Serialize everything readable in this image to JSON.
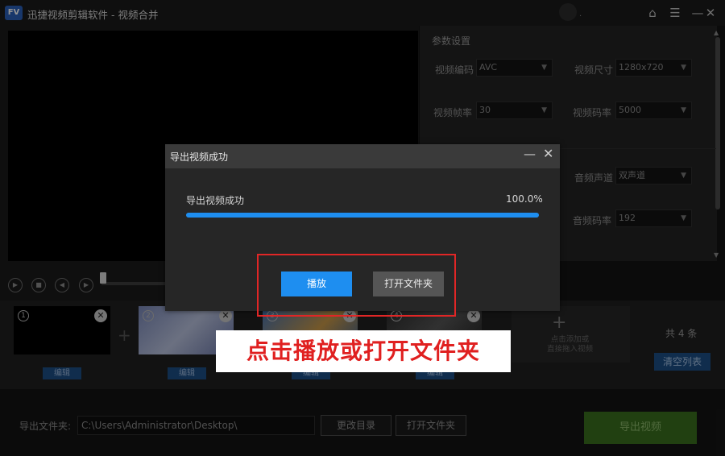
{
  "app": {
    "title": "迅捷视频剪辑软件 - 视频合并",
    "logo_text": "FV"
  },
  "window": {
    "home_icon": "⌂",
    "menu_icon": "☰",
    "close_icon": "✕",
    "user_suffix": "."
  },
  "settings": {
    "section_title": "参数设置",
    "params": [
      {
        "label": "视频编码",
        "value": "AVC"
      },
      {
        "label": "视频尺寸",
        "value": "1280x720"
      },
      {
        "label": "视频帧率",
        "value": "30"
      },
      {
        "label": "视频码率",
        "value": "5000"
      },
      {
        "label": "音频声道",
        "value": "双声道"
      },
      {
        "label": "音频码率",
        "value": "192"
      }
    ]
  },
  "clips": [
    {
      "num": "1",
      "edit": "编辑"
    },
    {
      "num": "2",
      "edit": "编辑"
    },
    {
      "num": "3",
      "edit": "编辑"
    },
    {
      "num": "4",
      "edit": "编辑"
    }
  ],
  "add_card": {
    "line1": "点击添加或",
    "line2": "直接拖入视频"
  },
  "count_text": "共 4 条",
  "clear_label": "清空列表",
  "export": {
    "folder_label": "导出文件夹:",
    "path": "C:\\Users\\Administrator\\Desktop\\",
    "change_dir": "更改目录",
    "open_folder": "打开文件夹",
    "export_video": "导出视频"
  },
  "modal": {
    "title": "导出视频成功",
    "status": "导出视频成功",
    "progress": 100.0,
    "progress_text": "100.0%",
    "play": "播放",
    "open_folder": "打开文件夹",
    "min_icon": "—",
    "close_icon": "✕"
  },
  "annotation": "点击播放或打开文件夹",
  "colors": {
    "accent": "#1e8ef0",
    "export_green": "#3a6e1e",
    "annotation_red": "#e02020"
  }
}
